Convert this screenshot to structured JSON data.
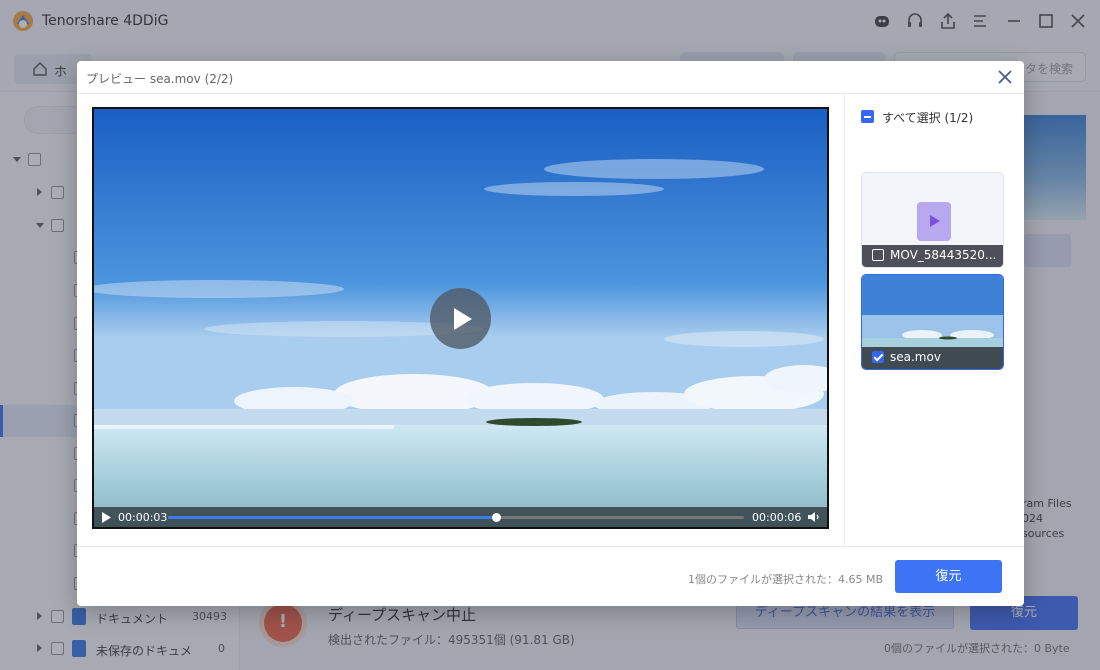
{
  "app": {
    "title": "Tenorshare 4DDiG",
    "icons": [
      "robot-icon",
      "headset-icon",
      "share-icon",
      "menu-icon",
      "minimize-icon",
      "maximize-icon",
      "close-icon"
    ]
  },
  "nav": {
    "home_tab": "ホ",
    "search_placeholder": "タを検索"
  },
  "sidebar": {
    "items": [
      {
        "label": "ドキュメント",
        "count": "30493"
      },
      {
        "label": "未保存のドキュメ",
        "count": "0"
      }
    ]
  },
  "status": {
    "scan_title": "ディープスキャン中止",
    "scan_detail": "検出されたファイル：495351個 (91.81 GB)",
    "deep_scan_button": "ディープスキャンの結果を表示",
    "recover_button": "復元",
    "selected_info": "0個のファイルが選択された：0 Byte"
  },
  "right_peek": {
    "lines": [
      "ram Files",
      "024",
      "sources"
    ]
  },
  "modal": {
    "title": "プレビュー sea.mov (2/2)",
    "player": {
      "current_time": "00:00:03",
      "end_time": "00:00:06",
      "progress": 0.57
    },
    "select_all": "すべて選択 (1/2)",
    "files": [
      {
        "name": "MOV_58443520...",
        "checked": false
      },
      {
        "name": "sea.mov",
        "checked": true
      }
    ],
    "footer_info": "1個のファイルが選択された：4.65 MB",
    "recover_button": "復元"
  },
  "colors": {
    "accent": "#3766f2",
    "stop": "#ea5a3e"
  }
}
